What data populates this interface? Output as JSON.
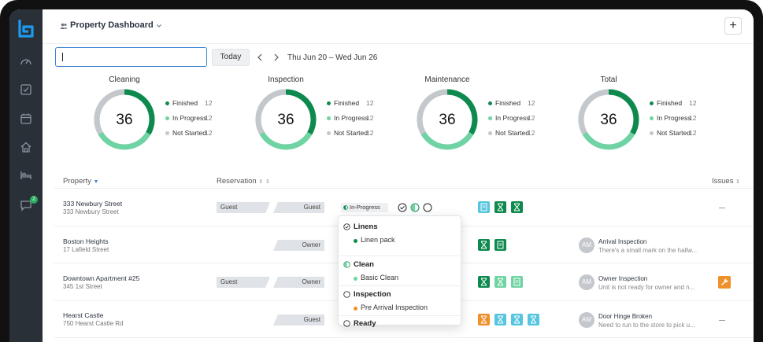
{
  "colors": {
    "dark_green": "#0f8a4f",
    "light_green": "#6fd3a3",
    "grey": "#c4c8cd",
    "teal_chip": "#56c5e0",
    "orange": "#f0902b",
    "accent": "#3b82d6"
  },
  "sidebar": {
    "logo": "b-logo-icon",
    "icons": [
      "speedometer-icon",
      "checkbox-icon",
      "calendar-icon",
      "home-icon",
      "bed-icon",
      "chat-icon"
    ],
    "chat_badge": "2"
  },
  "header": {
    "title": "Property Dashboard",
    "add_label": "+"
  },
  "toolbar": {
    "search_value": "",
    "today_label": "Today",
    "date_range": "Thu Jun 20 – Wed Jun 26"
  },
  "stats": [
    {
      "title": "Cleaning",
      "total": "36",
      "legend": [
        {
          "label": "Finished",
          "value": "12"
        },
        {
          "label": "In Progress",
          "value": "12"
        },
        {
          "label": "Not Started",
          "value": "12"
        }
      ]
    },
    {
      "title": "Inspection",
      "total": "36",
      "legend": [
        {
          "label": "Finished",
          "value": "12"
        },
        {
          "label": "In Progress",
          "value": "12"
        },
        {
          "label": "Not Started",
          "value": "12"
        }
      ]
    },
    {
      "title": "Maintenance",
      "total": "36",
      "legend": [
        {
          "label": "Finished",
          "value": "12"
        },
        {
          "label": "In Progress",
          "value": "12"
        },
        {
          "label": "Not Started",
          "value": "12"
        }
      ]
    },
    {
      "title": "Total",
      "total": "36",
      "legend": [
        {
          "label": "Finished",
          "value": "12"
        },
        {
          "label": "In Progress",
          "value": "12"
        },
        {
          "label": "Not Started",
          "value": "12"
        }
      ]
    }
  ],
  "table": {
    "headers": {
      "property": "Property",
      "reservation": "Reservation",
      "issues": "Issues"
    },
    "rows": [
      {
        "name": "333 Newbury Street",
        "address": "333 Newbury Street",
        "res_left": "Guest",
        "res_right": "Guest",
        "status": "In-Progress",
        "issue_title": "",
        "issue_note": ""
      },
      {
        "name": "Boston Heights",
        "address": "17 Lafield Street",
        "res_left": "",
        "res_right": "Owner",
        "status": "",
        "issue_title": "Arrival Inspection",
        "issue_note": "There's a small mark on the hallw..."
      },
      {
        "name": "Downtown Apartment #25",
        "address": "345 1st Street",
        "res_left": "Guest",
        "res_right": "Owner",
        "status": "",
        "issue_title": "Owner Inspection",
        "issue_note": "Unit is not ready for owner and n..."
      },
      {
        "name": "Hearst Castle",
        "address": "750 Hearst Castle Rd",
        "res_left": "",
        "res_right": "Guest",
        "status": "",
        "issue_title": "Door Hinge Broken",
        "issue_note": "Need to run to the store to pick u..."
      }
    ],
    "avatar_initials": "AM"
  },
  "popup": {
    "sections": [
      {
        "title": "Linens",
        "sub": "Linen pack",
        "state": "done"
      },
      {
        "title": "Clean",
        "sub": "Basic Clean",
        "state": "half"
      },
      {
        "title": "Inspection",
        "sub": "Pre Arrival Inspection",
        "state": "empty"
      },
      {
        "title": "Ready",
        "sub": "",
        "state": "empty"
      }
    ]
  }
}
